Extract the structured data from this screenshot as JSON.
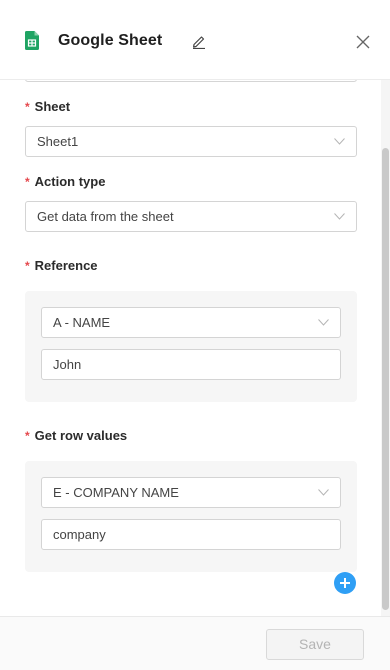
{
  "header": {
    "title": "Google Sheet",
    "icon": "google-sheets-icon",
    "accent": "#1fa463"
  },
  "form": {
    "sheet": {
      "label": "Sheet",
      "value": "Sheet1"
    },
    "action_type": {
      "label": "Action type",
      "value": "Get data from the sheet"
    },
    "reference": {
      "label": "Reference",
      "column": "A - NAME",
      "value": "John"
    },
    "get_row_values": {
      "label": "Get row values",
      "column": "E - COMPANY NAME",
      "value": "company"
    },
    "required_marker": "*"
  },
  "footer": {
    "save_label": "Save"
  },
  "colors": {
    "required": "#e5484d",
    "add_button": "#2f9ff5"
  }
}
